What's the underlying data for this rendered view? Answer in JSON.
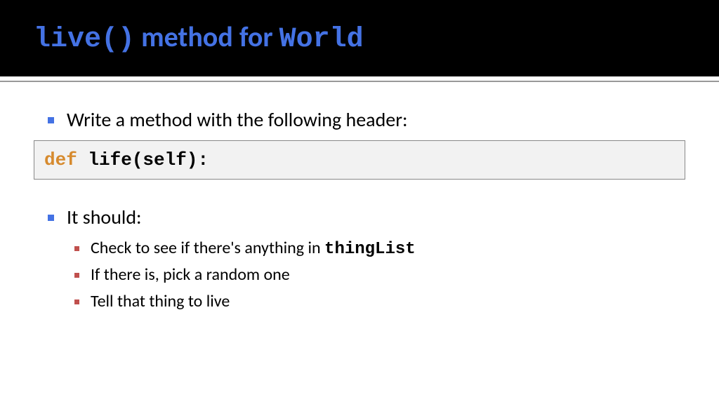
{
  "header": {
    "title_code_1": "live()",
    "title_mid": " method for ",
    "title_code_2": "World"
  },
  "content": {
    "bullet1": "Write a method with the following header:",
    "code": {
      "keyword": "def",
      "rest": " life(self):"
    },
    "bullet2": "It should:",
    "sub": [
      {
        "pre": "Check to see if there's anything in ",
        "code": "thingList",
        "post": ""
      },
      {
        "pre": "If there is, pick a random one",
        "code": "",
        "post": ""
      },
      {
        "pre": "Tell that thing to live",
        "code": "",
        "post": ""
      }
    ]
  }
}
